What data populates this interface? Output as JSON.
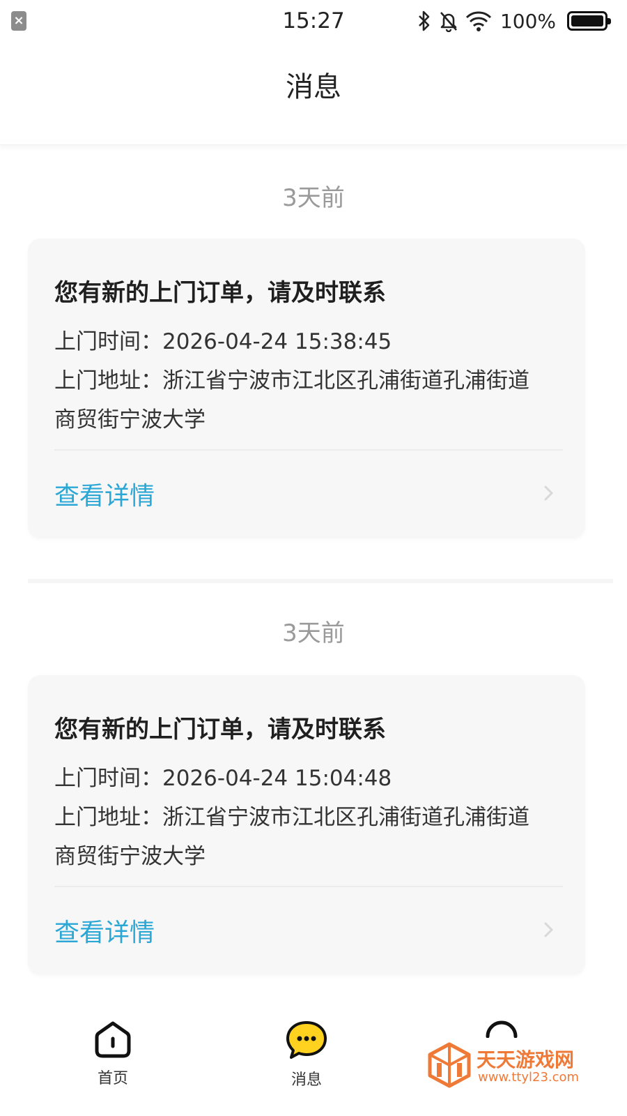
{
  "status_bar": {
    "time": "15:27",
    "battery": "100%"
  },
  "header": {
    "title": "消息"
  },
  "messages": [
    {
      "time_ago": "3天前",
      "title": "您有新的上门订单，请及时联系",
      "visit_time_label": "上门时间：",
      "visit_time": "2026-04-24 15:38:45",
      "address_label": "上门地址：",
      "address_line1": "浙江省宁波市江北区孔浦街道孔浦街道",
      "address_line2": "商贸街宁波大学",
      "detail_link": "查看详情"
    },
    {
      "time_ago": "3天前",
      "title": "您有新的上门订单，请及时联系",
      "visit_time_label": "上门时间：",
      "visit_time": "2026-04-24 15:04:48",
      "address_label": "上门地址：",
      "address_line1": "浙江省宁波市江北区孔浦街道孔浦街道",
      "address_line2": "商贸街宁波大学",
      "detail_link": "查看详情"
    }
  ],
  "bottom_nav": {
    "home": "首页",
    "messages": "消息"
  },
  "watermark": {
    "title": "天天游戏网",
    "url": "www.ttyl23.com"
  },
  "colors": {
    "link": "#2ba7d6",
    "active_tab": "#ffd21f",
    "watermark": "#ef7a38"
  }
}
